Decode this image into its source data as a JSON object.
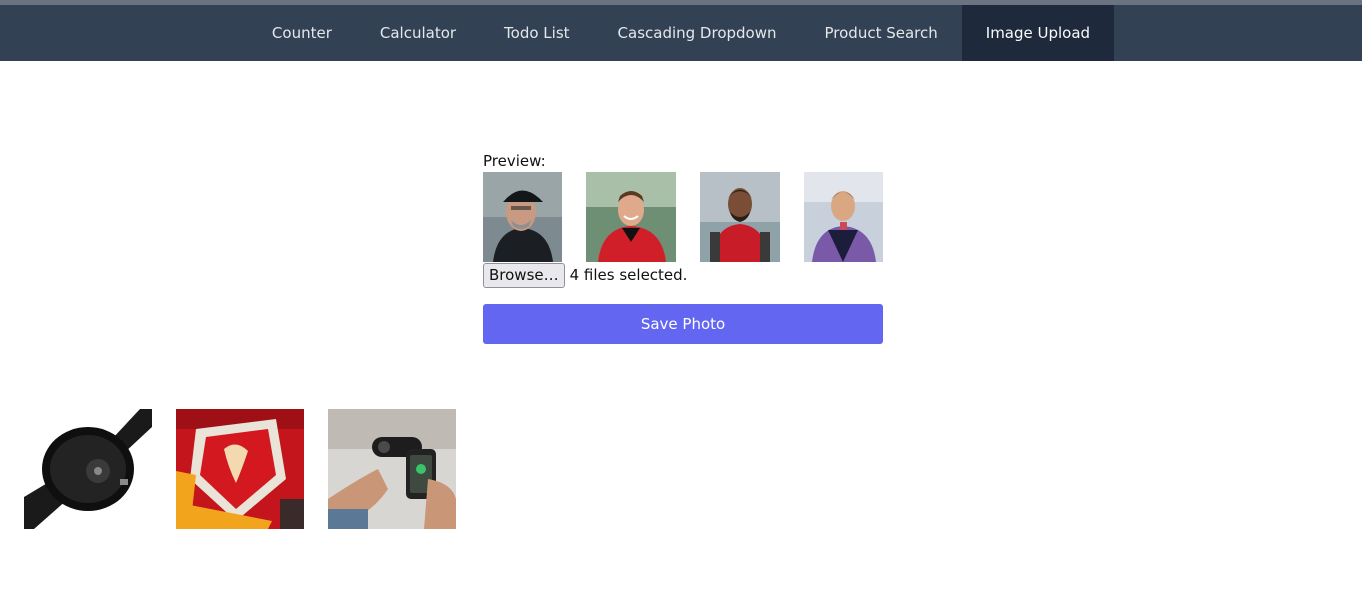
{
  "nav": {
    "items": [
      {
        "label": "Counter"
      },
      {
        "label": "Calculator"
      },
      {
        "label": "Todo List"
      },
      {
        "label": "Cascading Dropdown"
      },
      {
        "label": "Product Search"
      },
      {
        "label": "Image Upload"
      }
    ],
    "active": "Image Upload"
  },
  "uploader": {
    "preview_label": "Preview:",
    "browse_label": "Browse…",
    "file_status": "4 files selected.",
    "save_label": "Save Photo"
  },
  "preview_images": [
    {
      "subject": "man-in-cap-photo"
    },
    {
      "subject": "smiling-player-photo"
    },
    {
      "subject": "player-red-kit-photo"
    },
    {
      "subject": "player-purple-kit-photo"
    }
  ],
  "gallery_images": [
    {
      "subject": "watch-photo"
    },
    {
      "subject": "club-crest-flag-photo"
    },
    {
      "subject": "phone-gadget-photo"
    }
  ],
  "colors": {
    "nav_bg": "#334155",
    "nav_active_bg": "#1e293b",
    "save_button_bg": "#6366f1"
  }
}
